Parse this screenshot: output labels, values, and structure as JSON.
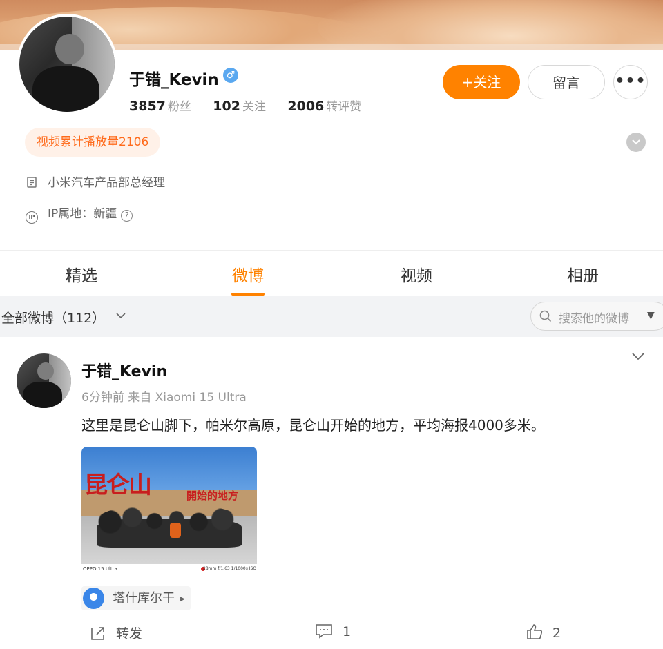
{
  "profile": {
    "name": "于错_Kevin",
    "gender_symbol": "♂",
    "followers_count": "3857",
    "followers_label": "粉丝",
    "following_count": "102",
    "following_label": "关注",
    "reposts_count": "2006",
    "reposts_label": "转评赞",
    "video_plays": "视频累计播放量2106",
    "description": "小米汽车产品部总经理",
    "ip_location": "IP属地：新疆",
    "ip_badge": "IP"
  },
  "actions": {
    "follow_label": "+关注",
    "message_label": "留言",
    "more_label": "•••"
  },
  "tabs": [
    {
      "label": "精选",
      "active": false
    },
    {
      "label": "微博",
      "active": true
    },
    {
      "label": "视频",
      "active": false
    },
    {
      "label": "相册",
      "active": false
    }
  ],
  "filter": {
    "label": "全部微博（112）",
    "search_placeholder": "搜索他的微博"
  },
  "post": {
    "author": "于错_Kevin",
    "meta": "6分钟前  来自 Xiaomi 15 Ultra",
    "text": "这里是昆仑山脚下，帕米尔高原，昆仑山开始的地方，平均海报4000多米。",
    "image": {
      "sign_main": "昆仑山",
      "sign_sub": "開始的地方",
      "caption_left": "OPPO 15 Ultra",
      "caption_right": "28mm  f/1.63  1/1000s  ISO"
    },
    "location": "塔什库尔干",
    "share_label": "转发",
    "comment_count": "1",
    "like_count": "2"
  },
  "colors": {
    "accent": "#ff8200",
    "pill_text": "#ff6a1a",
    "pill_bg": "#fff1e8",
    "location_pin": "#3a86e8"
  },
  "icons": [
    "gender-male-icon",
    "more-dots-icon",
    "expand-chevron-icon",
    "document-icon",
    "ip-icon",
    "help-icon",
    "chevron-down-icon",
    "search-icon",
    "caret-down-icon",
    "location-pin-icon",
    "share-icon",
    "comment-icon",
    "like-icon"
  ]
}
